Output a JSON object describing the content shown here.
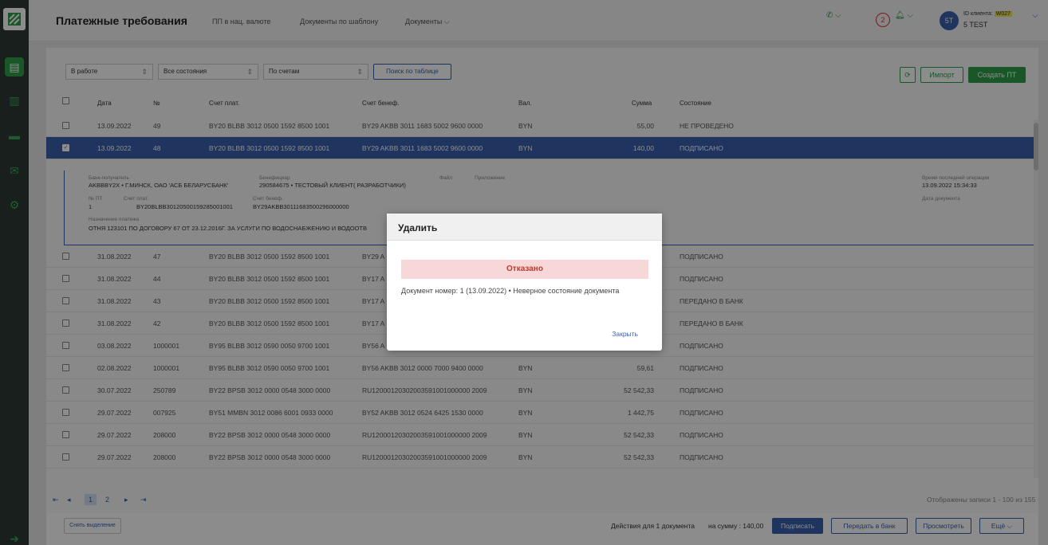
{
  "sidebar": {
    "items": [
      "document-icon",
      "book-icon",
      "card-icon",
      "mail-icon",
      "gear-icon"
    ],
    "logout": "logout-icon"
  },
  "header": {
    "title": "Платежные требования",
    "nav": [
      "ПП в нац. валюте",
      "Документы по шаблону",
      "Документы ⌵"
    ],
    "notif_count": "2",
    "avatar": "5T",
    "client_id_label": "ID клиента:",
    "client_id": "W027",
    "client_name": "5 TEST"
  },
  "toolbar": {
    "filter1": "В работе",
    "filter2": "Все состояния",
    "filter3": "По счетам",
    "search": "Поиск по таблице",
    "import": "Импорт",
    "create": "Создать ПТ"
  },
  "table": {
    "headers": [
      "Дата",
      "№",
      "Счет плат.",
      "Счет бенеф.",
      "Вал.",
      "Сумма",
      "Состояние"
    ],
    "rows": [
      {
        "date": "13.09.2022",
        "num": "49",
        "payer": "BY20 BLBB 3012 0500 1592 8500 1001",
        "benef": "BY29 AKBB 3011 1683 5002 9600 0000",
        "cur": "BYN",
        "sum": "55,00",
        "state": "НЕ ПРОВЕДЕНО"
      },
      {
        "date": "13.09.2022",
        "num": "48",
        "payer": "BY20 BLBB 3012 0500 1592 8500 1001",
        "benef": "BY29 AKBB 3011 1683 5002 9600 0000",
        "cur": "BYN",
        "sum": "140,00",
        "state": "ПОДПИСАНО"
      },
      {
        "date": "31.08.2022",
        "num": "47",
        "payer": "BY20 BLBB 3012 0500 1592 8500 1001",
        "benef": "BY29 A",
        "cur": "",
        "sum": "",
        "state": "ПОДПИСАНО"
      },
      {
        "date": "31.08.2022",
        "num": "44",
        "payer": "BY20 BLBB 3012 0500 1592 8500 1001",
        "benef": "BY17 A",
        "cur": "",
        "sum": "",
        "state": "ПОДПИСАНО"
      },
      {
        "date": "31.08.2022",
        "num": "43",
        "payer": "BY20 BLBB 3012 0500 1592 8500 1001",
        "benef": "BY17 A",
        "cur": "",
        "sum": "",
        "state": "ПЕРЕДАНО В БАНК"
      },
      {
        "date": "31.08.2022",
        "num": "42",
        "payer": "BY20 BLBB 3012 0500 1592 8500 1001",
        "benef": "BY17 A",
        "cur": "",
        "sum": "",
        "state": "ПЕРЕДАНО В БАНК"
      },
      {
        "date": "03.08.2022",
        "num": "1000001",
        "payer": "BY95 BLBB 3012 0590 0050 9700 1001",
        "benef": "BY56 A",
        "cur": "",
        "sum": "",
        "state": "ПОДПИСАНО"
      },
      {
        "date": "02.08.2022",
        "num": "1000001",
        "payer": "BY95 BLBB 3012 0590 0050 9700 1001",
        "benef": "BY56 AKBB 3012 0000 7000 9400 0000",
        "cur": "BYN",
        "sum": "59,61",
        "state": "ПОДПИСАНО"
      },
      {
        "date": "30.07.2022",
        "num": "250789",
        "payer": "BY22 BPSB 3012 0000 0548 3000 0000",
        "benef": "RU12000120302003591001000000 2009",
        "cur": "BYN",
        "sum": "52 542,33",
        "state": "ПОДПИСАНО"
      },
      {
        "date": "29.07.2022",
        "num": "007925",
        "payer": "BY51 MMBN 3012 0086 6001 0933 0000",
        "benef": "BY52 AKBB 3012 0524 6425 1530 0000",
        "cur": "BYN",
        "sum": "1 442,75",
        "state": "ПОДПИСАНО"
      },
      {
        "date": "29.07.2022",
        "num": "208000",
        "payer": "BY22 BPSB 3012 0000 0548 3000 0000",
        "benef": "RU12000120302003591001000000 2009",
        "cur": "BYN",
        "sum": "52 542,33",
        "state": "ПОДПИСАНО"
      },
      {
        "date": "29.07.2022",
        "num": "208000",
        "payer": "BY22 BPSB 3012 0000 0548 3000 0000",
        "benef": "RU12000120302003591001000000 2009",
        "cur": "BYN",
        "sum": "52 542,33",
        "state": "ПОДПИСАНО"
      }
    ]
  },
  "detail": {
    "bank_label": "Банк-получатель",
    "bank": "AKBBBY2X • Г.МИНСК, ОАО 'АСБ БЕЛАРУСБАНК'",
    "benef_label": "Бенефициар",
    "benef": "290584675 • ТЕСТОВЫЙ КЛИЕНТ( РАЗРАБОТЧИКИ)",
    "file_label": "Файл",
    "attach_label": "Приложение",
    "last_op_label": "Время последней операции",
    "last_op": "13.09.2022 15:34:33",
    "num_label": "№ ПТ",
    "num": "1",
    "payer_label": "Счет плат.",
    "payer": "BY20BLBB30120500159285001001",
    "benef_acc_label": "Счет бенеф.",
    "benef_acc": "BY29AKBB30111683500296000000",
    "doc_date_label": "Дата документа",
    "purpose_label": "Назначение платежа",
    "purpose": "ОТНЯ 123101 ПО ДОГОВОРУ 67 ОТ 23.12.2016Г. ЗА УСЛУГИ ПО ВОДОСНАБЖЕНИЮ И ВОДООТВ"
  },
  "pager": {
    "pages": [
      "1",
      "2"
    ],
    "summary": "Отображены записи 1 - 100 из 155"
  },
  "footer": {
    "clear": "Снять выделение",
    "actions": "Действия для 1 документа",
    "sum": "на сумму : 140,00",
    "sign": "Подписать",
    "send": "Передать в банк",
    "view": "Просмотреть",
    "more": "Ещё ⌵"
  },
  "modal": {
    "title": "Удалить",
    "alert": "Отказано",
    "message": "Документ номер: 1 (13.09.2022) • Неверное состояние документа",
    "close": "Закрыть"
  },
  "colors": {
    "brand": "#2f9e4a",
    "accent": "#3b5fb0",
    "danger": "#c0392b"
  }
}
